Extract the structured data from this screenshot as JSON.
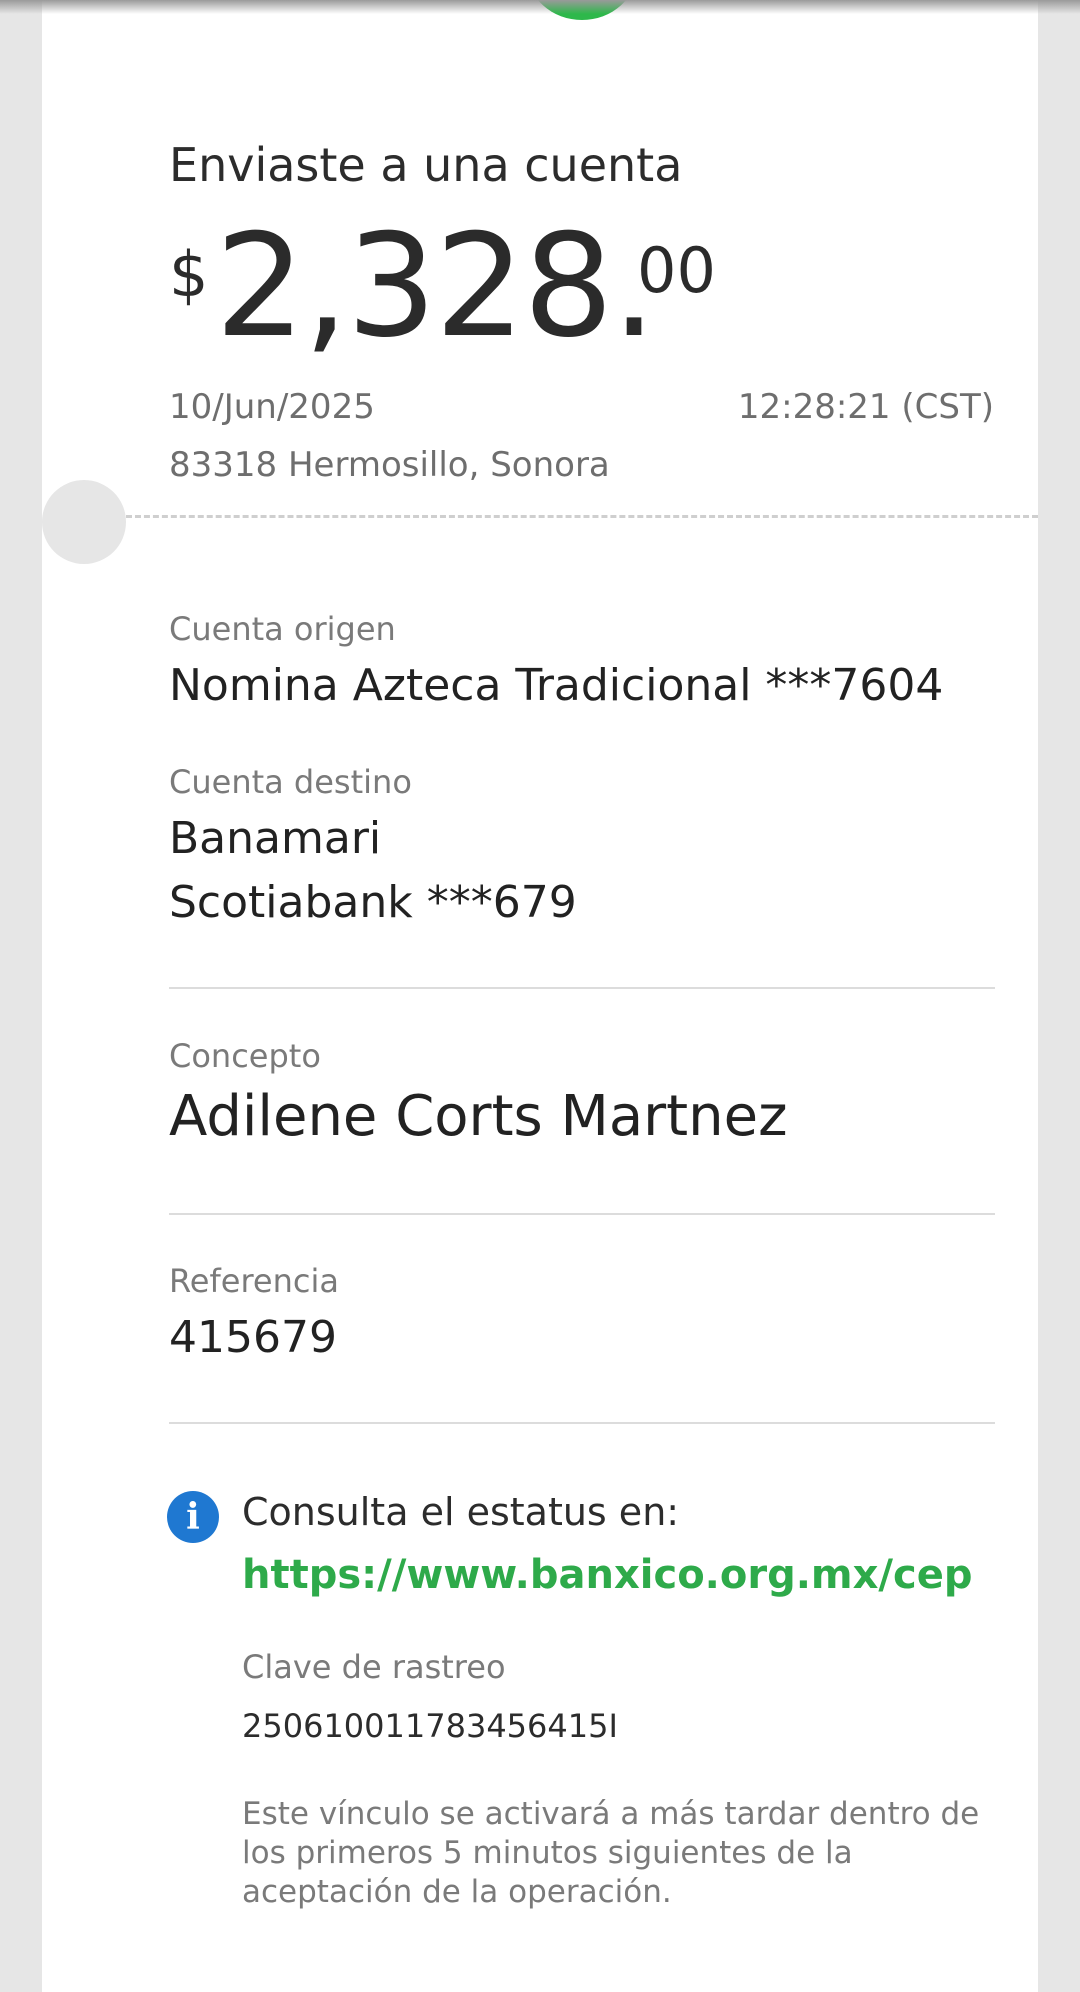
{
  "receipt": {
    "heading": "Enviaste a una cuenta",
    "amount": {
      "currency_symbol": "$",
      "integer": "2,328.",
      "cents": "00"
    },
    "date": "10/Jun/2025",
    "time": "12:28:21 (CST)",
    "location": "83318 Hermosillo, Sonora"
  },
  "details": {
    "origin_label": "Cuenta origen",
    "origin_value": "Nomina Azteca Tradicional ***7604",
    "destination_label": "Cuenta destino",
    "destination_name": "Banamari",
    "destination_account": "Scotiabank ***679",
    "concept_label": "Concepto",
    "concept_value": "Adilene Corts Martnez",
    "reference_label": "Referencia",
    "reference_value": "415679"
  },
  "status": {
    "icon": "info-icon",
    "consult_text": "Consulta el estatus en:",
    "link": "https://www.banxico.org.mx/cep",
    "tracking_label": "Clave de rastreo",
    "tracking_value": "25061001178345641​5I",
    "note": "Este vínculo se activará a más tardar dentro de los primeros 5 minutos siguientes de la aceptación de la operación."
  },
  "colors": {
    "accent_green": "#2eb84b",
    "info_blue": "#1f78d1",
    "link_green": "#2eaa4a"
  }
}
